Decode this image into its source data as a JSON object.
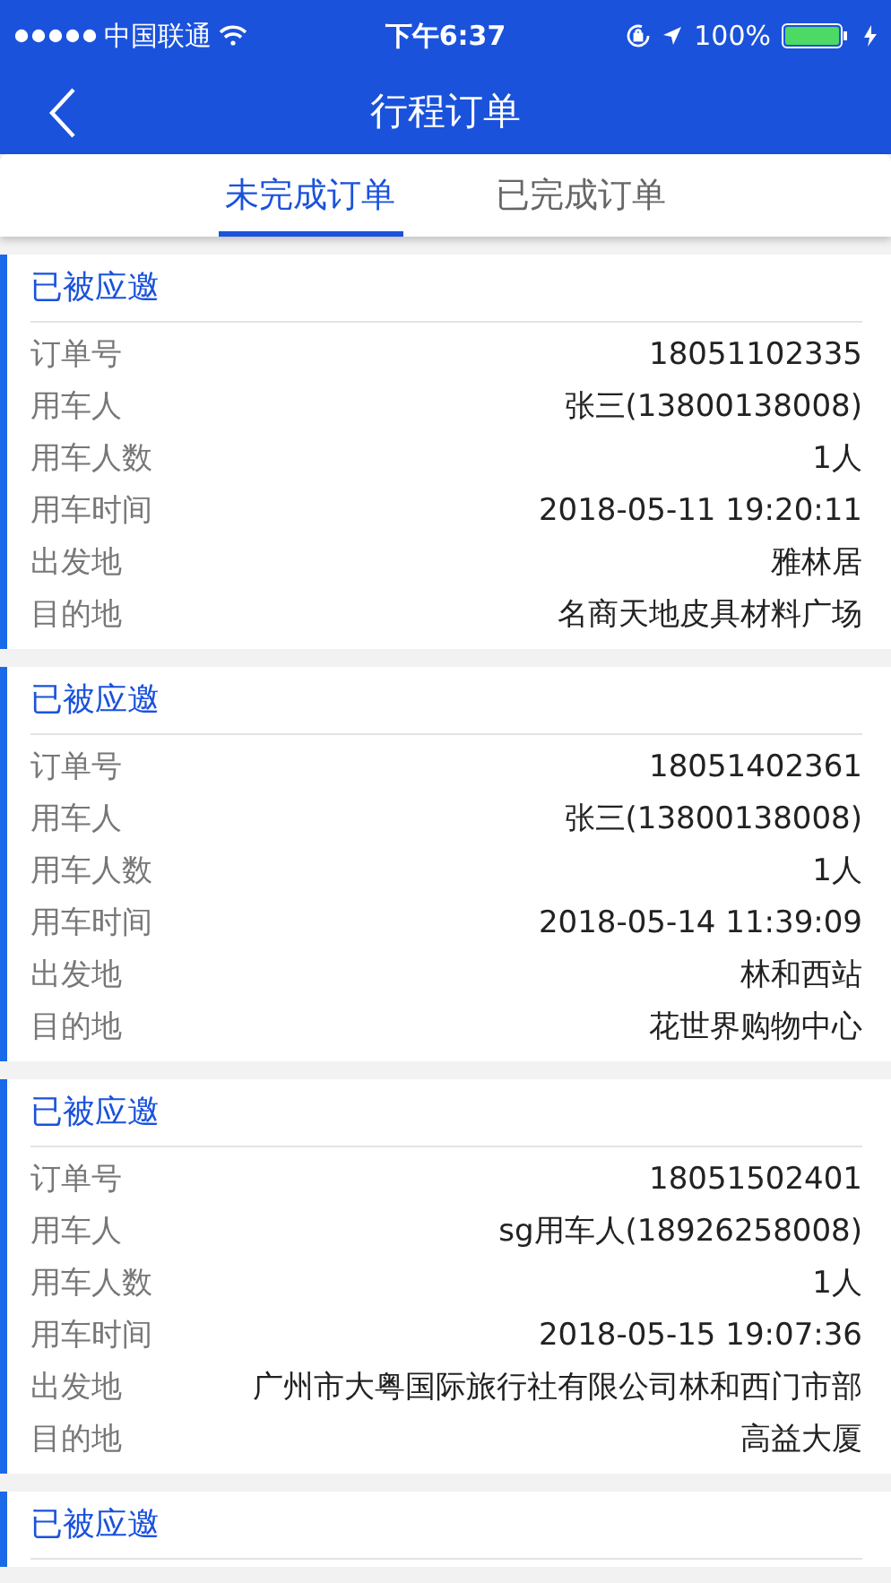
{
  "status_bar": {
    "carrier": "中国联通",
    "time": "下午6:37",
    "battery": "100%"
  },
  "nav": {
    "title": "行程订单"
  },
  "tabs": [
    {
      "label": "未完成订单",
      "selected": true
    },
    {
      "label": "已完成订单",
      "selected": false
    }
  ],
  "orders": [
    {
      "status": "已被应邀",
      "fields": [
        {
          "label": "订单号",
          "value": "18051102335"
        },
        {
          "label": "用车人",
          "value": "张三(13800138008)"
        },
        {
          "label": "用车人数",
          "value": "1人"
        },
        {
          "label": "用车时间",
          "value": "2018-05-11 19:20:11"
        },
        {
          "label": "出发地",
          "value": "雅林居"
        },
        {
          "label": "目的地",
          "value": "名商天地皮具材料广场"
        }
      ]
    },
    {
      "status": "已被应邀",
      "fields": [
        {
          "label": "订单号",
          "value": "18051402361"
        },
        {
          "label": "用车人",
          "value": "张三(13800138008)"
        },
        {
          "label": "用车人数",
          "value": "1人"
        },
        {
          "label": "用车时间",
          "value": "2018-05-14 11:39:09"
        },
        {
          "label": "出发地",
          "value": "林和西站"
        },
        {
          "label": "目的地",
          "value": "花世界购物中心"
        }
      ]
    },
    {
      "status": "已被应邀",
      "fields": [
        {
          "label": "订单号",
          "value": "18051502401"
        },
        {
          "label": "用车人",
          "value": "sg用车人(18926258008)"
        },
        {
          "label": "用车人数",
          "value": "1人"
        },
        {
          "label": "用车时间",
          "value": "2018-05-15 19:07:36"
        },
        {
          "label": "出发地",
          "value": "广州市大粤国际旅行社有限公司林和西门市部"
        },
        {
          "label": "目的地",
          "value": "高益大厦"
        }
      ]
    },
    {
      "status": "已被应邀"
    }
  ]
}
